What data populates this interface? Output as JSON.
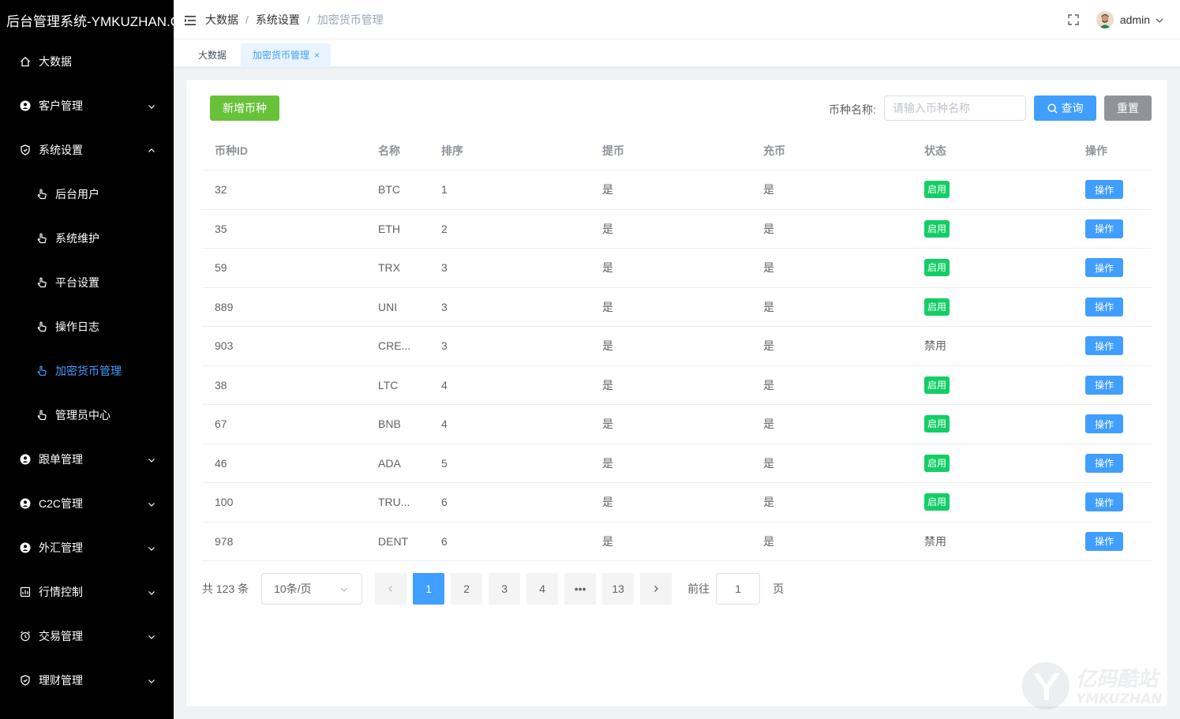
{
  "app": {
    "title": "后台管理系统-YMKUZHAN.COM"
  },
  "sidebar": {
    "items": [
      {
        "label": "大数据",
        "icon": "home-icon",
        "sub": false,
        "arrow": ""
      },
      {
        "label": "客户管理",
        "icon": "user-circle-icon",
        "sub": false,
        "arrow": "down"
      },
      {
        "label": "系统设置",
        "icon": "shield-icon",
        "sub": false,
        "arrow": "up"
      },
      {
        "label": "后台用户",
        "icon": "hand-pointer-icon",
        "sub": true,
        "arrow": ""
      },
      {
        "label": "系统维护",
        "icon": "hand-pointer-icon",
        "sub": true,
        "arrow": ""
      },
      {
        "label": "平台设置",
        "icon": "hand-pointer-icon",
        "sub": true,
        "arrow": ""
      },
      {
        "label": "操作日志",
        "icon": "hand-pointer-icon",
        "sub": true,
        "arrow": ""
      },
      {
        "label": "加密货币管理",
        "icon": "hand-pointer-icon",
        "sub": true,
        "arrow": "",
        "active": true
      },
      {
        "label": "管理员中心",
        "icon": "hand-pointer-icon",
        "sub": true,
        "arrow": ""
      },
      {
        "label": "跟单管理",
        "icon": "user-circle-icon",
        "sub": false,
        "arrow": "down"
      },
      {
        "label": "C2C管理",
        "icon": "user-circle-icon",
        "sub": false,
        "arrow": "down"
      },
      {
        "label": "外汇管理",
        "icon": "user-circle-icon",
        "sub": false,
        "arrow": "down"
      },
      {
        "label": "行情控制",
        "icon": "chart-box-icon",
        "sub": false,
        "arrow": "down"
      },
      {
        "label": "交易管理",
        "icon": "alarm-clock-icon",
        "sub": false,
        "arrow": "down"
      },
      {
        "label": "理财管理",
        "icon": "shield-icon",
        "sub": false,
        "arrow": "down"
      }
    ]
  },
  "header": {
    "breadcrumb": [
      "大数据",
      "系统设置",
      "加密货币管理"
    ],
    "separator": "/",
    "username": "admin"
  },
  "tags": [
    {
      "label": "大数据"
    },
    {
      "label": "加密货币管理",
      "close": "×"
    }
  ],
  "toolbar": {
    "add_label": "新增币种",
    "search_label": "币种名称:",
    "search_placeholder": "请输入币种名称",
    "query_label": "查询",
    "reset_label": "重置"
  },
  "table": {
    "columns": [
      "币种ID",
      "名称",
      "排序",
      "提币",
      "充币",
      "状态",
      "操作"
    ],
    "rows": [
      {
        "id": "32",
        "name": "BTC",
        "sort": "1",
        "withdraw": "是",
        "deposit": "是",
        "status": "启用",
        "enabled": true,
        "action": "操作"
      },
      {
        "id": "35",
        "name": "ETH",
        "sort": "2",
        "withdraw": "是",
        "deposit": "是",
        "status": "启用",
        "enabled": true,
        "action": "操作"
      },
      {
        "id": "59",
        "name": "TRX",
        "sort": "3",
        "withdraw": "是",
        "deposit": "是",
        "status": "启用",
        "enabled": true,
        "action": "操作"
      },
      {
        "id": "889",
        "name": "UNI",
        "sort": "3",
        "withdraw": "是",
        "deposit": "是",
        "status": "启用",
        "enabled": true,
        "action": "操作"
      },
      {
        "id": "903",
        "name": "CRE...",
        "sort": "3",
        "withdraw": "是",
        "deposit": "是",
        "status": "禁用",
        "enabled": false,
        "action": "操作"
      },
      {
        "id": "38",
        "name": "LTC",
        "sort": "4",
        "withdraw": "是",
        "deposit": "是",
        "status": "启用",
        "enabled": true,
        "action": "操作"
      },
      {
        "id": "67",
        "name": "BNB",
        "sort": "4",
        "withdraw": "是",
        "deposit": "是",
        "status": "启用",
        "enabled": true,
        "action": "操作"
      },
      {
        "id": "46",
        "name": "ADA",
        "sort": "5",
        "withdraw": "是",
        "deposit": "是",
        "status": "启用",
        "enabled": true,
        "action": "操作"
      },
      {
        "id": "100",
        "name": "TRU...",
        "sort": "6",
        "withdraw": "是",
        "deposit": "是",
        "status": "启用",
        "enabled": true,
        "action": "操作"
      },
      {
        "id": "978",
        "name": "DENT",
        "sort": "6",
        "withdraw": "是",
        "deposit": "是",
        "status": "禁用",
        "enabled": false,
        "action": "操作"
      }
    ]
  },
  "pagination": {
    "total_label": "共 123 条",
    "page_size": "10条/页",
    "pages": [
      "1",
      "2",
      "3",
      "4",
      "•••",
      "13"
    ],
    "current": "1",
    "goto_label": "前往",
    "goto_value": "1",
    "goto_suffix": "页"
  },
  "watermark": {
    "text": "亿码酷站",
    "subtext": "YMKUZHAN"
  },
  "colors": {
    "sidebar_bg": "#000000",
    "primary": "#409eff",
    "success": "#67c23a",
    "status_on": "#13ce66",
    "info": "#909399"
  }
}
